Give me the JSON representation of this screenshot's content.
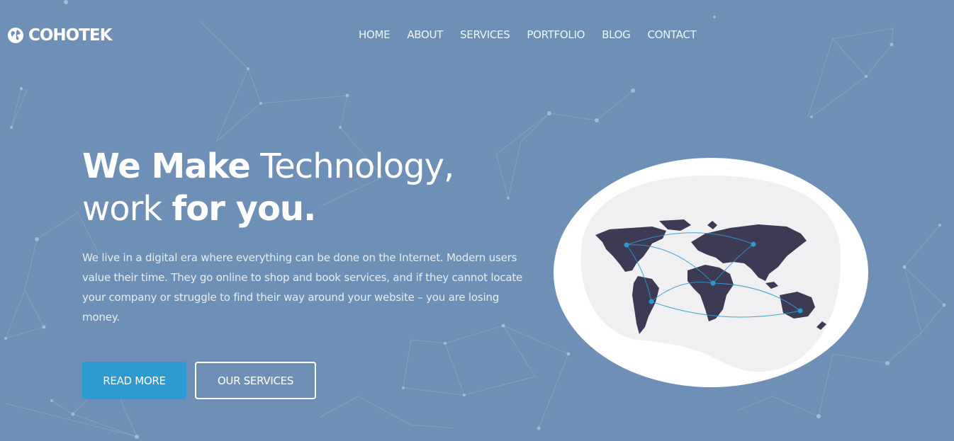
{
  "brand": {
    "name": "COHOTEK",
    "icon": "globe-icon"
  },
  "nav": {
    "items": [
      {
        "label": "HOME"
      },
      {
        "label": "ABOUT"
      },
      {
        "label": "SERVICES"
      },
      {
        "label": "PORTFOLIO"
      },
      {
        "label": "BLOG"
      },
      {
        "label": "CONTACT"
      }
    ]
  },
  "hero": {
    "line1_bold": "We Make",
    "line1_light": " Technology,",
    "line2_light": "work ",
    "line2_bold": "for you.",
    "paragraph": "We live in a digital era where everything can be done on the Internet. Modern users value their time. They go online to shop and book services, and if they cannot locate your company or struggle to find their way around your website – you are losing money.",
    "primary_button": "READ MORE",
    "secondary_button": "OUR SERVICES"
  },
  "illustration": {
    "icon": "world-map-icon"
  },
  "colors": {
    "background": "#6f90b6",
    "accent": "#2d9bd1",
    "map_land": "#3d3a54",
    "map_blob": "#f0f0f2"
  }
}
